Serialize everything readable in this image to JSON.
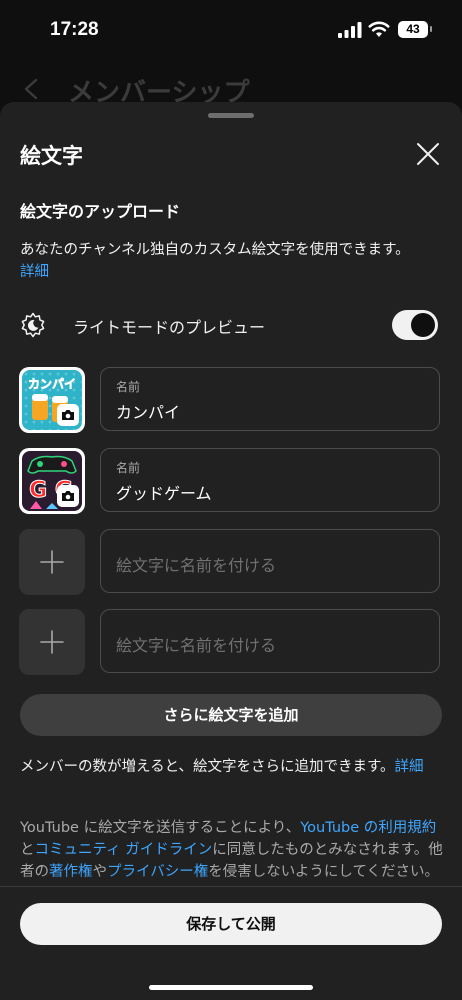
{
  "status_bar": {
    "time": "17:28",
    "battery": "43"
  },
  "background_page": {
    "title": "メンバーシップ"
  },
  "sheet": {
    "title": "絵文字",
    "section_title": "絵文字のアップロード",
    "description": "あなたのチャンネル独自のカスタム絵文字を使用できます。",
    "description_link": "詳細",
    "preview": {
      "label": "ライトモードのプレビュー",
      "enabled": true
    },
    "emojis": [
      {
        "label": "名前",
        "value": "カンパイ",
        "image_text": "カンパイ"
      },
      {
        "label": "名前",
        "value": "グッドゲーム",
        "image_text": "G G"
      }
    ],
    "empty_slots": [
      {
        "placeholder": "絵文字に名前を付ける"
      },
      {
        "placeholder": "絵文字に名前を付ける"
      }
    ],
    "add_more_button": "さらに絵文字を追加",
    "note_text": "メンバーの数が増えると、絵文字をさらに追加できます。",
    "note_link": "詳細",
    "legal": {
      "part1": "YouTube に絵文字を送信することにより、",
      "link1": "YouTube の利用規約",
      "part2": "と",
      "link2": "コミュニティ ガイドライン",
      "part3": "に同意したものとみなされます。他者の",
      "link3": "著作権",
      "part4": "や",
      "link4": "プライバシー権",
      "part5": "を侵害しないようにしてください。"
    },
    "publish_button": "保存して公開"
  },
  "colors": {
    "link": "#3ea6ff",
    "sheet_bg": "#212121",
    "page_bg": "#0f0f0f"
  }
}
